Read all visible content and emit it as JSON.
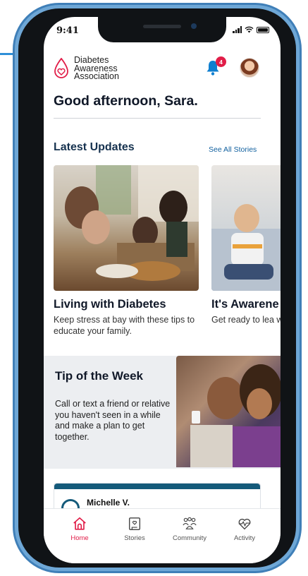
{
  "status_bar": {
    "time": "9:41"
  },
  "header": {
    "org_name_lines": [
      "Diabetes",
      "Awareness",
      "Association"
    ],
    "notification_count": "4",
    "greeting": "Good afternoon, Sara."
  },
  "latest_updates": {
    "title": "Latest Updates",
    "see_all": "See All  Stories",
    "cards": [
      {
        "title": "Living with Diabetes",
        "body": "Keep stress at bay with these tips to educate your family."
      },
      {
        "title": "It's Awarene",
        "body": "Get ready to lea with your Asso"
      }
    ]
  },
  "tip": {
    "title": "Tip of the Week",
    "body": "Call or text a friend or relative you haven't seen in a while and make a plan to get together."
  },
  "feed": {
    "author": "Michelle V."
  },
  "tabs": [
    {
      "label": "Home",
      "icon": "home-icon"
    },
    {
      "label": "Stories",
      "icon": "stories-icon"
    },
    {
      "label": "Community",
      "icon": "community-icon"
    },
    {
      "label": "Activity",
      "icon": "activity-icon"
    }
  ],
  "colors": {
    "accent": "#e11d48",
    "heading": "#16324f",
    "link": "#0f5f9e",
    "feed_bar": "#145a7a"
  }
}
